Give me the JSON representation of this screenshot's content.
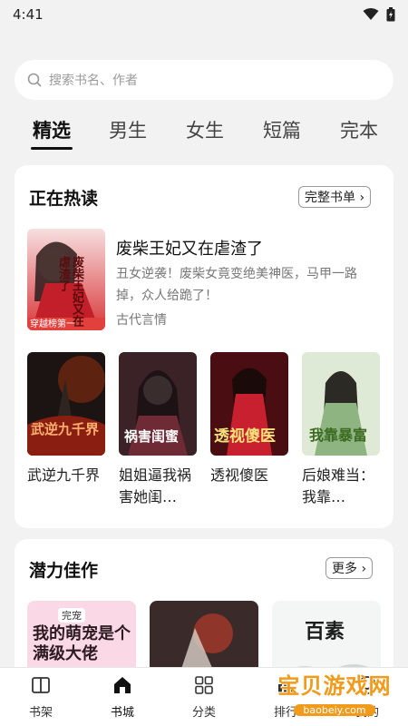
{
  "status_bar": {
    "time": "4:41"
  },
  "search": {
    "placeholder": "搜索书名、作者"
  },
  "tabs": [
    {
      "label": "精选"
    },
    {
      "label": "男生"
    },
    {
      "label": "女生"
    },
    {
      "label": "短篇"
    },
    {
      "label": "完本"
    }
  ],
  "hot": {
    "title": "正在热读",
    "button": "完整书单 ›",
    "featured": {
      "title": "废柴王妃又在虐渣了",
      "desc": "丑女逆袭！废柴女竟变绝美神医，马甲一路掉，众人给跪了！",
      "genre": "古代言情",
      "badge": "穿越榜第一",
      "cover_text": "废柴王妃又在虐渣了"
    },
    "books": [
      {
        "title": "武逆九千界",
        "cover_text": "武逆九千界"
      },
      {
        "title": "姐姐逼我祸害她闺…",
        "cover_text": "祸害闺蜜"
      },
      {
        "title": "透视傻医",
        "cover_text": "透视傻医"
      },
      {
        "title": "后娘难当：我靠…",
        "cover_text": "我靠暴富"
      }
    ]
  },
  "potential": {
    "title": "潜力佳作",
    "button": "更多 ›",
    "books": [
      {
        "cover_text": "我的萌宠是个满级大佬",
        "cover_small": "完宠"
      },
      {
        "cover_text": ""
      },
      {
        "cover_text": "百素"
      }
    ]
  },
  "bottom_nav": [
    {
      "label": "书架",
      "icon": "bookshelf-icon"
    },
    {
      "label": "书城",
      "icon": "bookstore-home-icon"
    },
    {
      "label": "分类",
      "icon": "category-grid-icon"
    },
    {
      "label": "排行",
      "icon": "ranking-icon"
    },
    {
      "label": "我的",
      "icon": "profile-icon"
    }
  ],
  "watermark": {
    "title": "宝贝游戏网",
    "url": "baobeiy.com"
  },
  "colors": {
    "accent": "#f29a1a",
    "background": "#f2f2f2",
    "card": "#ffffff"
  }
}
